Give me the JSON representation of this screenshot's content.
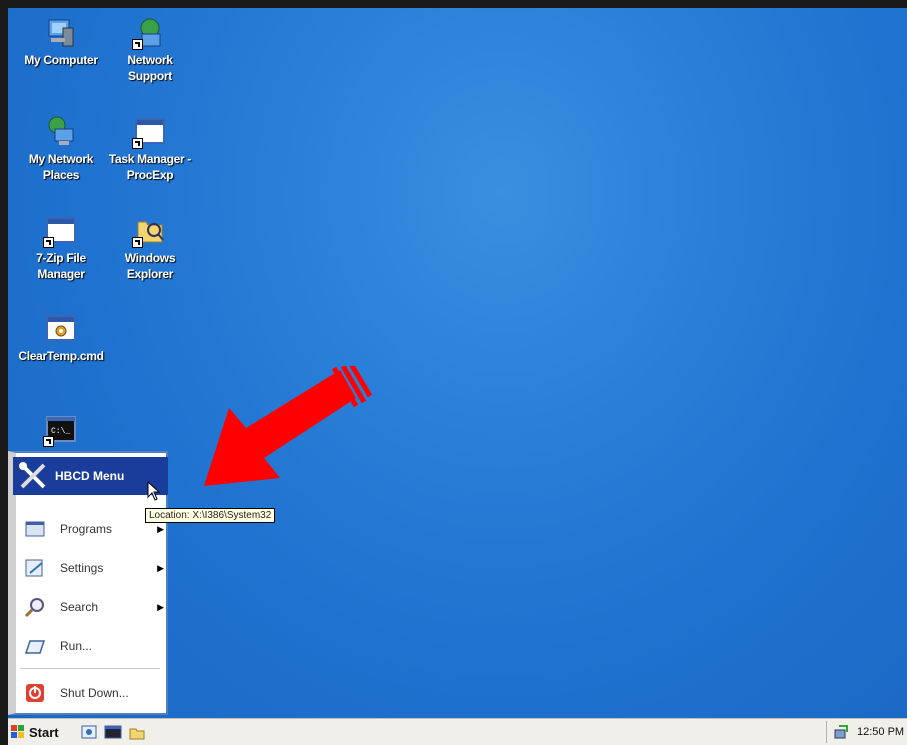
{
  "desktop": {
    "icons": [
      {
        "label_lines": [
          "My Computer"
        ],
        "icon": "computer-icon"
      },
      {
        "label_lines": [
          "Network",
          "Support"
        ],
        "icon": "network-support-icon"
      },
      {
        "label_lines": [
          "My Network",
          "Places"
        ],
        "icon": "network-places-icon"
      },
      {
        "label_lines": [
          "Task Manager -",
          "ProcExp"
        ],
        "icon": "task-manager-icon"
      },
      {
        "label_lines": [
          "7-Zip File",
          "Manager"
        ],
        "icon": "7zip-icon"
      },
      {
        "label_lines": [
          "Windows",
          "Explorer"
        ],
        "icon": "explorer-icon"
      },
      {
        "label_lines": [
          "ClearTemp.cmd"
        ],
        "icon": "cmd-script-icon"
      },
      {
        "label_lines": [
          ""
        ],
        "icon": "console-icon"
      }
    ],
    "background_color": "#2a7fd8"
  },
  "start_menu": {
    "highlighted_item": "HBCD Menu",
    "items": [
      {
        "label": "Programs",
        "icon": "programs-icon",
        "submenu": true
      },
      {
        "label": "Settings",
        "icon": "settings-icon",
        "submenu": true
      },
      {
        "label": "Search",
        "icon": "search-icon",
        "submenu": true
      },
      {
        "label": "Run...",
        "icon": "run-icon",
        "submenu": false
      },
      {
        "label": "Shut Down...",
        "icon": "shutdown-icon",
        "submenu": false
      }
    ]
  },
  "tooltip": "Location: X:\\I386\\System32",
  "taskbar": {
    "start_label": "Start",
    "clock": "12:50 PM"
  },
  "annotation": {
    "arrow_color": "#ff0000"
  }
}
